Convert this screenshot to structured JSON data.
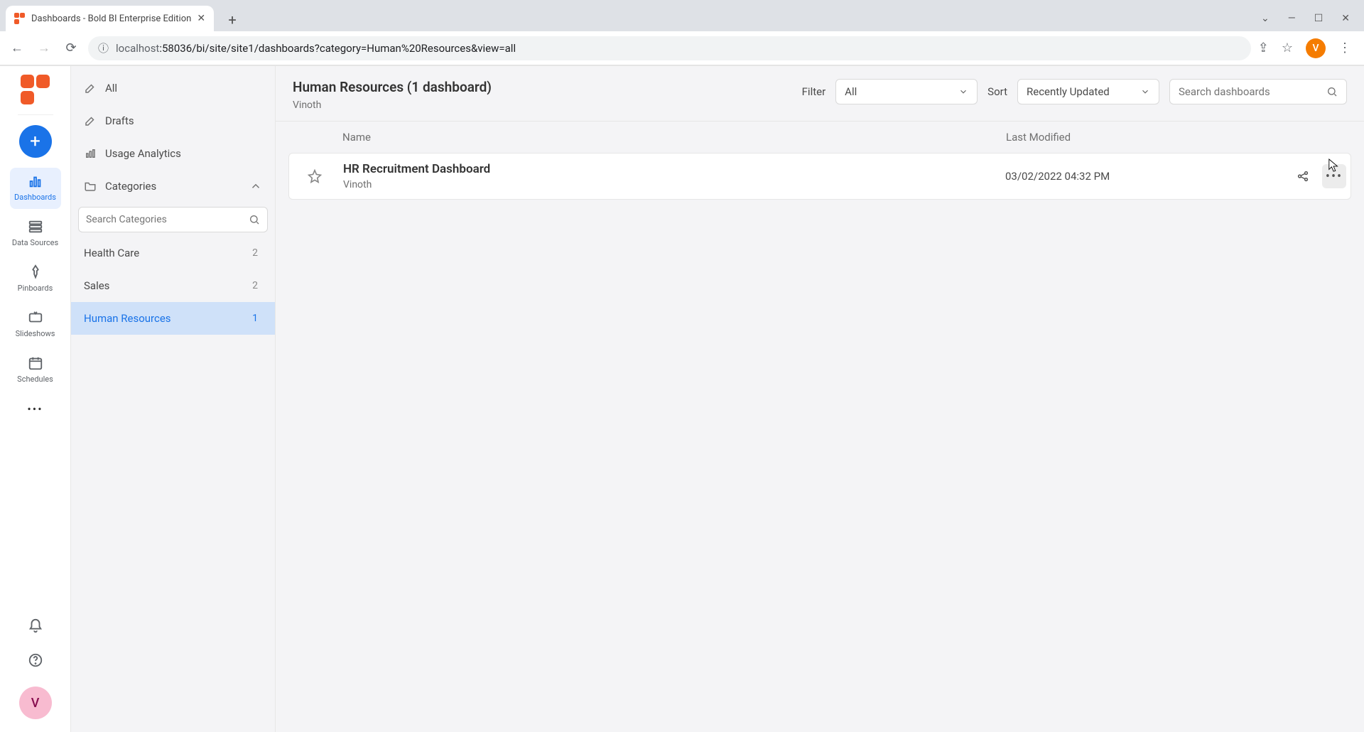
{
  "browser": {
    "tab_title": "Dashboards - Bold BI Enterprise Edition",
    "url_host": "localhost",
    "url_path": ":58036/bi/site/site1/dashboards?category=Human%20Resources&view=all",
    "avatar_letter": "V"
  },
  "rail": {
    "items": [
      {
        "label": "Dashboards",
        "icon": "bar"
      },
      {
        "label": "Data Sources",
        "icon": "stack"
      },
      {
        "label": "Pinboards",
        "icon": "pin"
      },
      {
        "label": "Slideshows",
        "icon": "display"
      },
      {
        "label": "Schedules",
        "icon": "calendar"
      }
    ],
    "avatar_letter": "V"
  },
  "sidebar": {
    "items": [
      {
        "label": "All",
        "icon": "edit"
      },
      {
        "label": "Drafts",
        "icon": "edit"
      },
      {
        "label": "Usage Analytics",
        "icon": "chart"
      },
      {
        "label": "Categories",
        "icon": "folder"
      }
    ],
    "search_placeholder": "Search Categories",
    "categories": [
      {
        "name": "Health Care",
        "count": "2"
      },
      {
        "name": "Sales",
        "count": "2"
      },
      {
        "name": "Human Resources",
        "count": "1"
      }
    ]
  },
  "main": {
    "heading": "Human Resources (1 dashboard)",
    "sub": "Vinoth",
    "filter_label": "Filter",
    "filter_value": "All",
    "sort_label": "Sort",
    "sort_value": "Recently Updated",
    "search_placeholder": "Search dashboards",
    "columns": {
      "name": "Name",
      "modified": "Last Modified"
    },
    "rows": [
      {
        "title": "HR Recruitment Dashboard",
        "author": "Vinoth",
        "modified": "03/02/2022 04:32 PM"
      }
    ]
  }
}
